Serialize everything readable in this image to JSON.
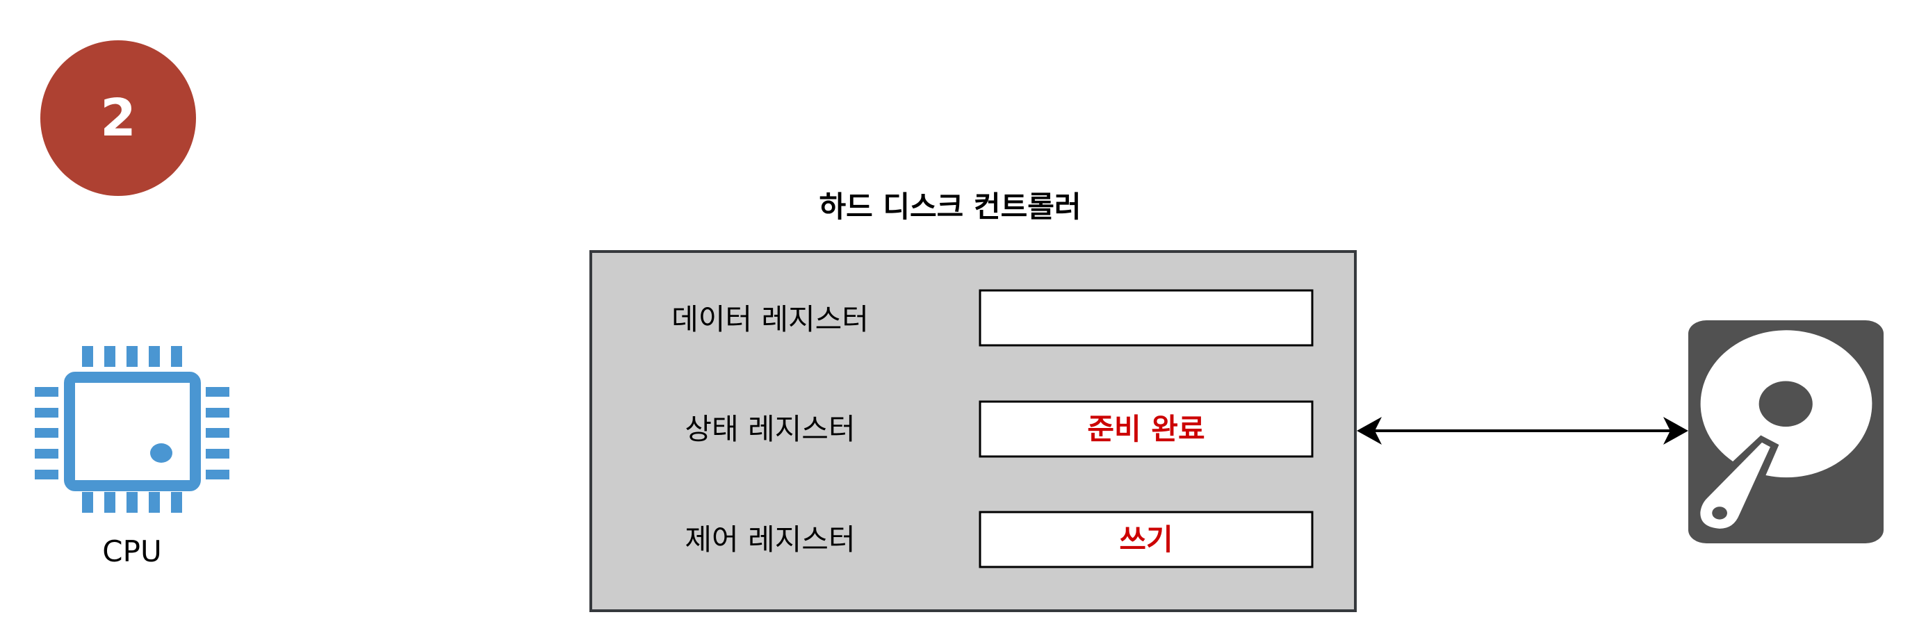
{
  "step_badge": {
    "number": "2",
    "color": "#ae4132"
  },
  "cpu": {
    "label": "CPU",
    "icon": "cpu-chip-icon",
    "color": "#4a96d2"
  },
  "controller": {
    "title": "하드 디스크 컨트롤러",
    "fill": "#cccccc",
    "registers": [
      {
        "name": "데이터 레지스터",
        "value": ""
      },
      {
        "name": "상태 레지스터",
        "value": "준비 완료"
      },
      {
        "name": "제어 레지스터",
        "value": "쓰기"
      }
    ],
    "value_color": "#cc0000"
  },
  "connection": {
    "type": "bidirectional-arrow"
  },
  "disk": {
    "icon": "hard-disk-icon",
    "color": "#515151"
  }
}
